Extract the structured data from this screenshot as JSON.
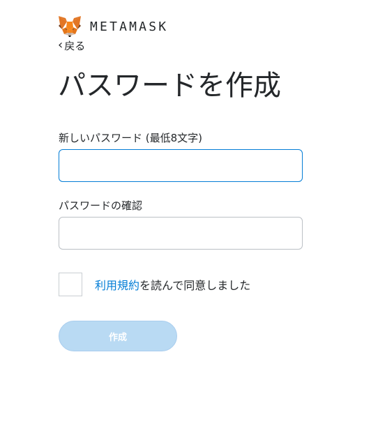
{
  "brand": {
    "wordmark": "METAMASK",
    "logo_icon": "metamask-fox-icon"
  },
  "nav": {
    "back_label": "戻る",
    "back_icon": "chevron-left-icon"
  },
  "page": {
    "title": "パスワードを作成"
  },
  "form": {
    "new_password_label": "新しいパスワード (最低8文字)",
    "new_password_value": "",
    "confirm_password_label": "パスワードの確認",
    "confirm_password_value": "",
    "terms_checked": false,
    "terms_link": "利用規約",
    "terms_suffix": "を読んで同意しました",
    "create_button_label": "作成"
  },
  "colors": {
    "accent": "#037dd6",
    "button_disabled_bg": "#b9daf3",
    "text": "#24272a",
    "border": "#bbc0c5"
  }
}
